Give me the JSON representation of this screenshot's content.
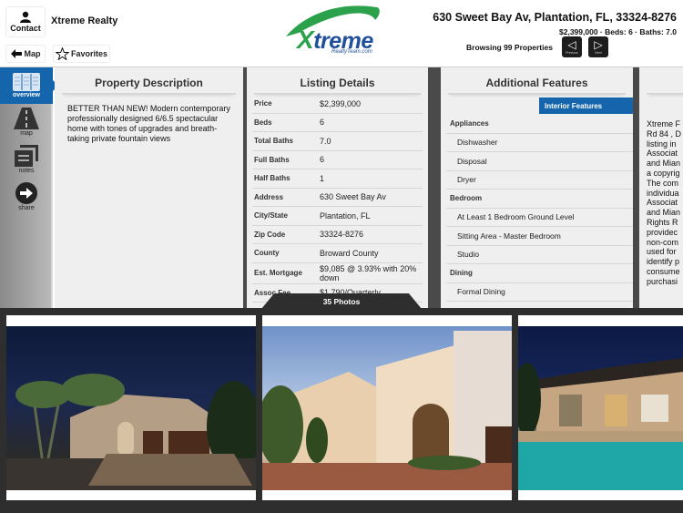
{
  "header": {
    "contact_label": "Contact",
    "agent_name": "Xtreme Realty",
    "map_label": "Map",
    "favorites_label": "Favorites",
    "logo_main": "Xtreme",
    "logo_sub": "RealtyTeam.com",
    "address_title": "630 Sweet Bay Av, Plantation, FL, 33324-8276",
    "summary": "$2,399,000 · Beds: 6 · Baths: 7.0",
    "browsing": "Browsing 99 Properties",
    "previous_label": "Previous",
    "next_label": "Next"
  },
  "sidebar": {
    "items": [
      {
        "label": "overview",
        "icon": "overview-icon",
        "active": true
      },
      {
        "label": "map",
        "icon": "road-icon"
      },
      {
        "label": "notes",
        "icon": "notes-icon"
      },
      {
        "label": "share",
        "icon": "share-arrow-icon"
      }
    ]
  },
  "description": {
    "title": "Property Description",
    "text": "BETTER THAN NEW! Modern contemporary professionally designed 6/6.5 spectacular home with tones of upgrades and breath-taking private fountain views"
  },
  "listing": {
    "title": "Listing Details",
    "rows": [
      {
        "k": "Price",
        "v": "$2,399,000"
      },
      {
        "k": "Beds",
        "v": "6"
      },
      {
        "k": "Total Baths",
        "v": "7.0"
      },
      {
        "k": "Full Baths",
        "v": "6"
      },
      {
        "k": "Half Baths",
        "v": "1"
      },
      {
        "k": "Address",
        "v": "630 Sweet Bay Av"
      },
      {
        "k": "City/State",
        "v": "Plantation, FL"
      },
      {
        "k": "Zip Code",
        "v": "33324-8276"
      },
      {
        "k": "County",
        "v": "Broward County"
      },
      {
        "k": "Est. Mortgage",
        "v": "$9,085 @ 3.93% with 20% down"
      },
      {
        "k": "Assoc Fee",
        "v": "$1,790/Quarterly"
      }
    ]
  },
  "features": {
    "title": "Additional Features",
    "active_tab": "Interior Features",
    "rows": [
      {
        "t": "group",
        "label": "Appliances"
      },
      {
        "t": "item",
        "label": "Dishwasher"
      },
      {
        "t": "item",
        "label": "Disposal"
      },
      {
        "t": "item",
        "label": "Dryer"
      },
      {
        "t": "group",
        "label": "Bedroom"
      },
      {
        "t": "item",
        "label": "At Least 1 Bedroom Ground Level"
      },
      {
        "t": "item",
        "label": "Sitting Area - Master Bedroom"
      },
      {
        "t": "item",
        "label": "Studio"
      },
      {
        "t": "group",
        "label": "Dining"
      },
      {
        "t": "item",
        "label": "Formal Dining"
      }
    ]
  },
  "disclaimer": {
    "lines": [
      "Xtreme F",
      "Rd 84 , D",
      "listing in",
      "Associat",
      "and Mian",
      "a copyrig",
      "The com",
      "individua",
      "Associat",
      "and Mian",
      "Rights R",
      "providec",
      "non-com",
      "used for",
      "identify p",
      "consume",
      "purchasi"
    ]
  },
  "photos": {
    "count_label": "35 Photos",
    "items": [
      {
        "alt": "Front exterior at night"
      },
      {
        "alt": "Front entrance at dusk"
      },
      {
        "alt": "Backyard pool at night"
      }
    ]
  }
}
